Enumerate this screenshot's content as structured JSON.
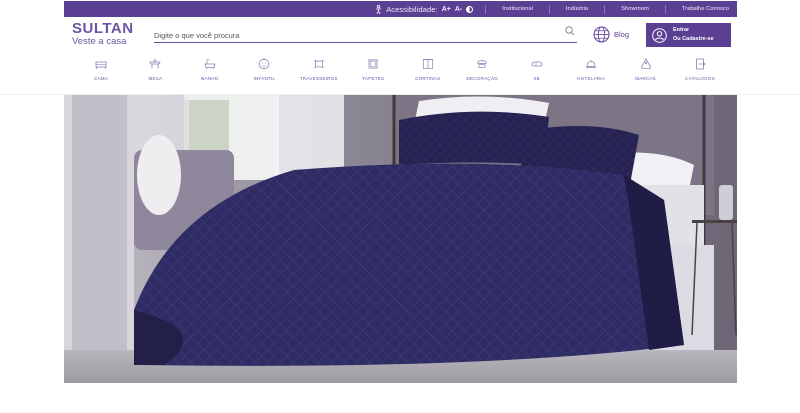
{
  "topbar": {
    "accessibility_label": "Acessibilidade:",
    "font_increase": "A+",
    "font_decrease": "A-",
    "links": [
      "Institucional",
      "Indústria",
      "Showroom",
      "Trabalhe Conosco"
    ]
  },
  "header": {
    "logo_line1": "SULTAN",
    "logo_line2": "Veste a casa",
    "search_placeholder": "Digite o que você procura",
    "blog_label": "Blog",
    "login_line1": "Entrar",
    "login_line2": "Ou Cadastre-se"
  },
  "categories": [
    {
      "label": "CAMA",
      "icon": "bed-icon"
    },
    {
      "label": "MESA",
      "icon": "table-icon"
    },
    {
      "label": "BANHO",
      "icon": "bathtub-icon"
    },
    {
      "label": "INFANTIL",
      "icon": "baby-icon"
    },
    {
      "label": "TRAVESSEIROS",
      "icon": "pillow-icon"
    },
    {
      "label": "TAPETES",
      "icon": "rug-icon"
    },
    {
      "label": "CORTINAS",
      "icon": "curtain-icon"
    },
    {
      "label": "DECORAÇÃO",
      "icon": "lamp-icon"
    },
    {
      "label": "SB",
      "icon": "slipper-icon"
    },
    {
      "label": "HOTELARIA",
      "icon": "hotel-bell-icon"
    },
    {
      "label": "MARCAS",
      "icon": "tag-icon"
    },
    {
      "label": "CATALOGOS",
      "icon": "catalog-icon"
    }
  ],
  "colors": {
    "brand_purple": "#5a3f92",
    "accent_lavender": "#6c56a3",
    "quilt_navy": "#2d2a5c"
  }
}
